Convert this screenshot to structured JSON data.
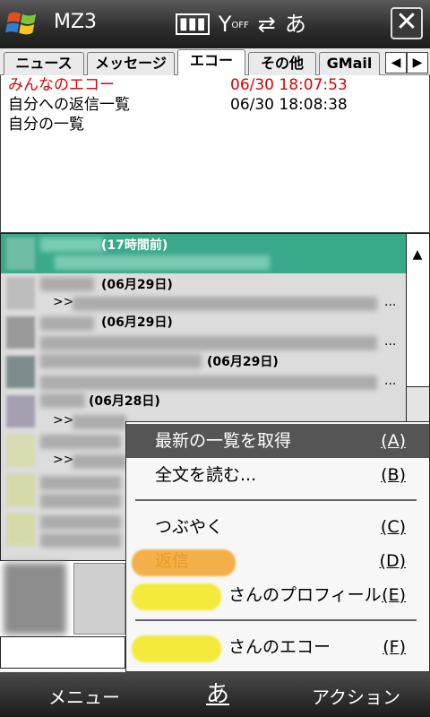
{
  "app": {
    "title": "MZ3",
    "close": "✕"
  },
  "status": {
    "battery": "▮▮▮",
    "signal": "Y",
    "signal_off": "OFF",
    "sync": "⇄",
    "ime": "あ"
  },
  "tabs": [
    "ニュース",
    "メッセージ",
    "エコー",
    "その他",
    "GMail"
  ],
  "tab_arrows": {
    "left": "◀",
    "right": "▶"
  },
  "toplist": [
    {
      "label": "みんなのエコー",
      "date": "06/30 18:07:53"
    },
    {
      "label": "自分への返信一覧",
      "date": "06/30 18:08:38"
    },
    {
      "label": "自分の一覧",
      "date": ""
    }
  ],
  "timeline": [
    {
      "date": "(17時間前)",
      "reply": ""
    },
    {
      "date": "(06月29日)",
      "reply": ">>"
    },
    {
      "date": "(06月29日)",
      "reply": ""
    },
    {
      "date": "(06月29日)",
      "reply": ""
    },
    {
      "date": "(06月28日)",
      "reply": ">>"
    },
    {
      "date": "",
      "reply": ">>"
    }
  ],
  "ellipsis": "...",
  "menu": {
    "items": [
      {
        "label": "最新の一覧を取得",
        "key": "(A)"
      },
      {
        "label": "全文を読む...",
        "key": "(B)"
      },
      {
        "label": "つぶやく",
        "key": "(C)"
      },
      {
        "label": "返信",
        "key": "(D)"
      },
      {
        "label": "さんのプロフィール",
        "key": "(E)"
      },
      {
        "label": "さんのエコー",
        "key": "(F)"
      }
    ]
  },
  "softkeys": {
    "left": "メニュー",
    "mid": "あ",
    "right": "アクション"
  },
  "colors": {
    "accent": "#3aa98a",
    "red": "#e00000",
    "highlight": "#555555",
    "yellow": "#f3ea3c",
    "orange": "#f4b048"
  }
}
